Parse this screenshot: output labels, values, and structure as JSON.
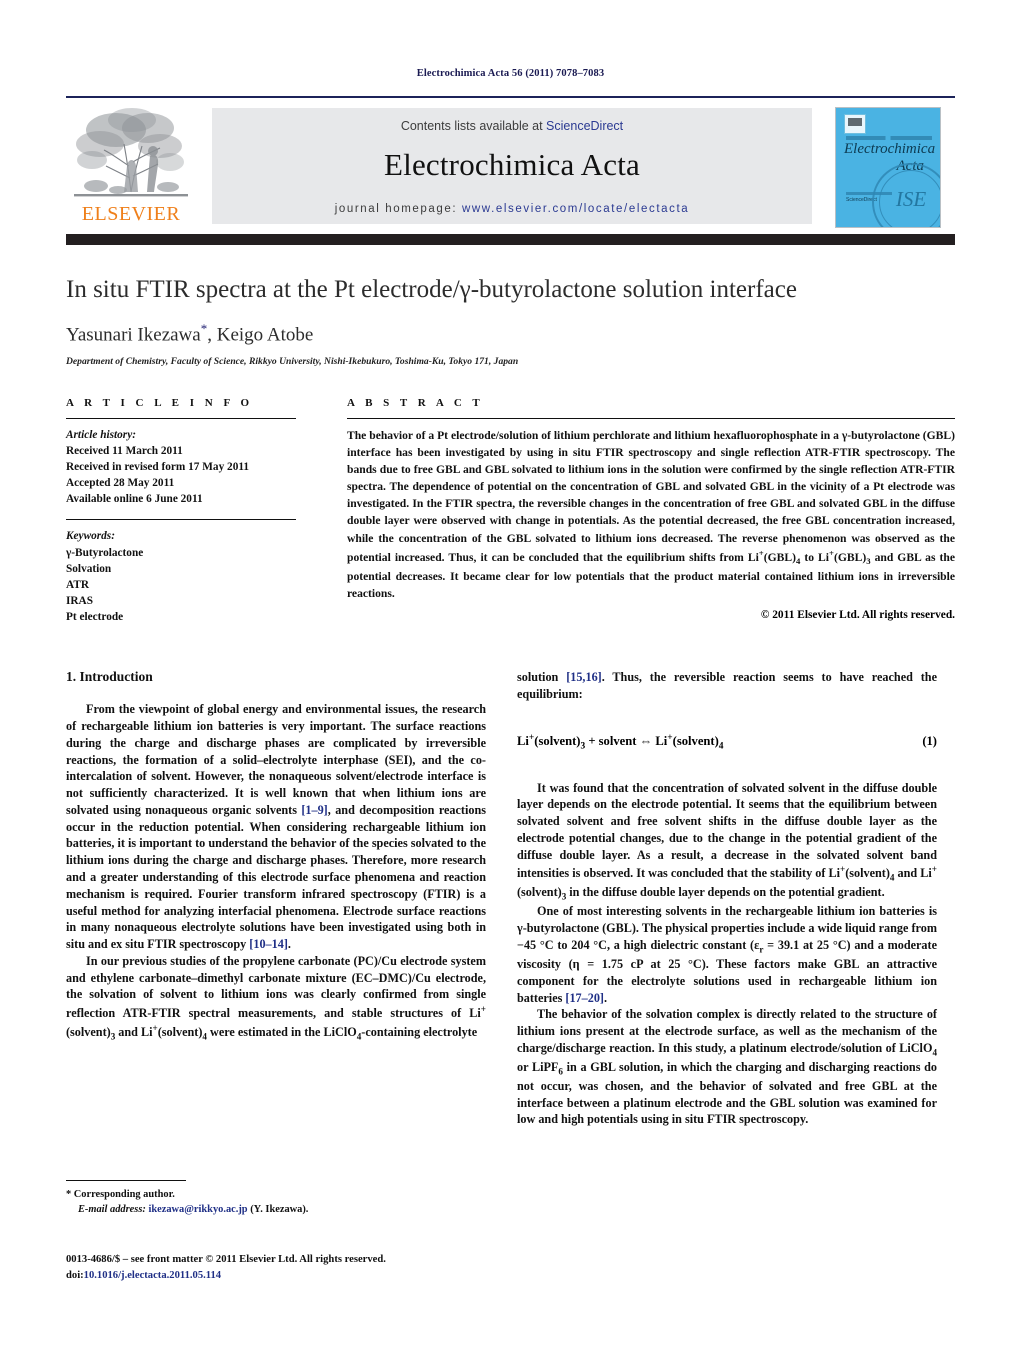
{
  "running_head": "Electrochimica Acta 56 (2011) 7078–7083",
  "masthead": {
    "publisher_name": "ELSEVIER",
    "contents_prefix": "Contents lists available at ",
    "contents_link": "ScienceDirect",
    "journal_title": "Electrochimica Acta",
    "homepage_prefix": "journal homepage: ",
    "homepage_url": "www.elsevier.com/locate/electacta",
    "cover": {
      "title_line1": "Electrochimica",
      "title_line2": "Acta",
      "sciencedirect_label": "ScienceDirect",
      "society_logo_text": "ISE"
    }
  },
  "article": {
    "title": "In situ FTIR spectra at the Pt electrode/γ-butyrolactone solution interface",
    "authors": "Yasunari Ikezawa",
    "author_marker": "*",
    "authors_rest": ", Keigo Atobe",
    "affiliation": "Department of Chemistry, Faculty of Science, Rikkyo University, Nishi-Ikebukuro, Toshima-Ku, Tokyo 171, Japan"
  },
  "article_info": {
    "heading": "A R T I C L E    I N F O",
    "history_label": "Article history:",
    "history": [
      "Received 11 March 2011",
      "Received in revised form 17 May 2011",
      "Accepted 28 May 2011",
      "Available online 6 June 2011"
    ],
    "keywords_label": "Keywords:",
    "keywords": [
      "γ-Butyrolactone",
      "Solvation",
      "ATR",
      "IRAS",
      "Pt electrode"
    ]
  },
  "abstract": {
    "heading": "A B S T R A C T",
    "text_part1": "The behavior of a Pt electrode/solution of lithium perchlorate and lithium hexafluorophosphate in a γ-butyrolactone (GBL) interface has been investigated by using in situ FTIR spectroscopy and single reflection ATR-FTIR spectroscopy. The bands due to free GBL and GBL solvated to lithium ions in the solution were confirmed by the single reflection ATR-FTIR spectra. The dependence of potential on the concentration of GBL and solvated GBL in the vicinity of a Pt electrode was investigated. In the FTIR spectra, the reversible changes in the concentration of free GBL and solvated GBL in the diffuse double layer were observed with change in potentials. As the potential decreased, the free GBL concentration increased, while the concentration of the GBL solvated to lithium ions decreased. The reverse phenomenon was observed as the potential increased. Thus, it can be concluded that the equilibrium shifts from Li",
    "sup1": "+",
    "text_part2": "(GBL)",
    "sub1": "4",
    "text_part3": " to Li",
    "sup2": "+",
    "text_part4": "(GBL)",
    "sub2": "3",
    "text_part5": " and GBL as the potential decreases. It became clear for low potentials that the product material contained lithium ions in irreversible reactions.",
    "copyright": "© 2011 Elsevier Ltd. All rights reserved."
  },
  "sections": {
    "intro_heading": "1.  Introduction",
    "left_p1_a": "From the viewpoint of global energy and environmental issues, the research of rechargeable lithium ion batteries is very important. The surface reactions during the charge and discharge phases are complicated by irreversible reactions, the formation of a solid–electrolyte interphase (SEI), and the co-intercalation of solvent. However, the nonaqueous solvent/electrode interface is not sufficiently characterized. It is well known that when lithium ions are solvated using nonaqueous organic solvents ",
    "left_p1_ref1": "[1–9]",
    "left_p1_b": ", and decomposition reactions occur in the reduction potential. When considering rechargeable lithium ion batteries, it is important to understand the behavior of the species solvated to the lithium ions during the charge and discharge phases. Therefore, more research and a greater understanding of this electrode surface phenomena and reaction mechanism is required. Fourier transform infrared spectroscopy (FTIR) is a useful method for analyzing interfacial phenomena. Electrode surface reactions in many nonaqueous electrolyte solutions have been investigated using both in situ and ex situ FTIR spectroscopy ",
    "left_p1_ref2": "[10–14]",
    "left_p1_c": ".",
    "left_p2_a": "In our previous studies of the propylene carbonate (PC)/Cu electrode system and ethylene carbonate–dimethyl carbonate mixture (EC–DMC)/Cu electrode, the solvation of solvent to lithium ions was clearly confirmed from single reflection ATR-FTIR spectral measurements, and stable structures of Li",
    "left_p2_sup1": "+",
    "left_p2_b": "(solvent)",
    "left_p2_sub1": "3",
    "left_p2_c": " and Li",
    "left_p2_sup2": "+",
    "left_p2_d": "(solvent)",
    "left_p2_sub2": "4",
    "left_p2_e": " were estimated in the LiClO",
    "left_p2_sub3": "4",
    "left_p2_f": "-containing electrolyte",
    "right_p0_a": "solution ",
    "right_p0_ref": "[15,16]",
    "right_p0_b": ". Thus, the reversible reaction seems to have reached the equilibrium:",
    "equation": {
      "left": "Li",
      "sup_a": "+",
      "mid_a": "(solvent)",
      "sub_a": "3",
      "mid_b": " + solvent  ⇔  Li",
      "sup_b": "+",
      "mid_c": "(solvent)",
      "sub_b": "4",
      "number": "(1)"
    },
    "right_p1": "It was found that the concentration of solvated solvent in the diffuse double layer depends on the electrode potential. It seems that the equilibrium between solvated solvent and free solvent shifts in the diffuse double layer as the electrode potential changes, due to the change in the potential gradient of the diffuse double layer. As a result, a decrease in the solvated solvent band intensities is observed. It was concluded that the stability of Li",
    "right_p1_sup1": "+",
    "right_p1_b": "(solvent)",
    "right_p1_sub1": "4",
    "right_p1_c": " and Li",
    "right_p1_sup2": "+",
    "right_p1_d": "(solvent)",
    "right_p1_sub2": "3",
    "right_p1_e": " in the diffuse double layer depends on the potential gradient.",
    "right_p2_a": "One of most interesting solvents in the rechargeable lithium ion batteries is γ-butyrolactone (GBL). The physical properties include a wide liquid range from −45 °C to 204 °C, a high dielectric constant (ε",
    "right_p2_sub1": "r",
    "right_p2_b": " = 39.1 at 25 °C) and a moderate viscosity (η = 1.75 cP at 25 °C). These factors make GBL an attractive component for the electrolyte solutions used in rechargeable lithium ion batteries ",
    "right_p2_ref": "[17–20]",
    "right_p2_c": ".",
    "right_p3_a": "The behavior of the solvation complex is directly related to the structure of lithium ions present at the electrode surface, as well as the mechanism of the charge/discharge reaction. In this study, a platinum electrode/solution of LiClO",
    "right_p3_sub1": "4",
    "right_p3_b": " or LiPF",
    "right_p3_sub2": "6",
    "right_p3_c": " in a GBL solution, in which the charging and discharging reactions do not occur, was chosen, and the behavior of solvated and free GBL at the interface between a platinum electrode and the GBL solution was examined for low and high potentials using in situ FTIR spectroscopy."
  },
  "footnotes": {
    "corresponding": "*  Corresponding author.",
    "email_label": "E-mail address:",
    "email": "ikezawa@rikkyo.ac.jp",
    "email_suffix": " (Y. Ikezawa).",
    "issn_line": "0013-4686/$ – see front matter © 2011 Elsevier Ltd. All rights reserved.",
    "doi_label": "doi:",
    "doi": "10.1016/j.electacta.2011.05.114"
  }
}
